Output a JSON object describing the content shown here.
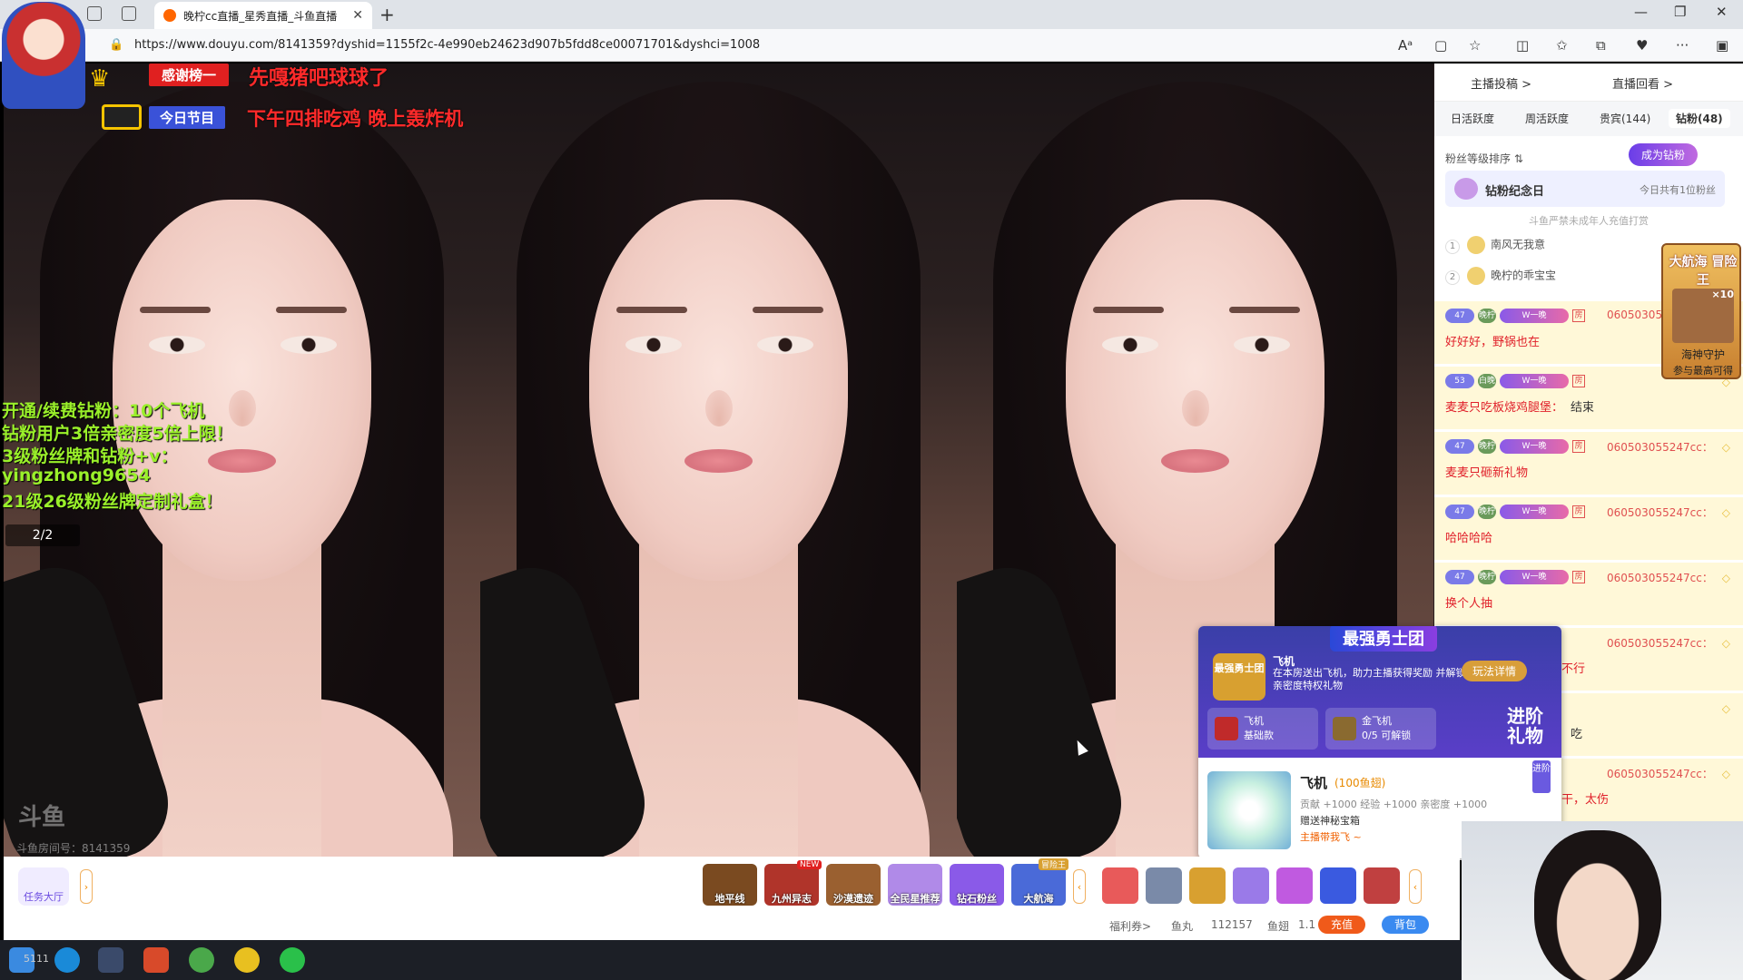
{
  "browser": {
    "tab_title": "晚柠cc直播_星秀直播_斗鱼直播",
    "url": "https://www.douyu.com/8141359?dyshid=1155f2c-4e990eb24623d907b5fdd8ce00071701&dyshci=1008",
    "icons": [
      "lock-icon",
      "read-aloud-icon",
      "reader-icon",
      "favorite-icon",
      "split-icon",
      "favorites-icon",
      "collections-icon",
      "extensions-icon",
      "more-icon",
      "sidebar-icon"
    ]
  },
  "overlay": {
    "thanks_badge": "感谢榜一",
    "thanks_text": "先嘎猪吧球球了",
    "today_badge": "今日节目",
    "today_text": "下午四排吃鸡 晚上轰炸机",
    "promo_lines": [
      "开通/续费钻粉：10个飞机",
      "钻粉用户3倍亲密度5倍上限！",
      "3级粉丝牌和钻粉+v：",
      "yingzhong9654",
      "21级26级粉丝牌定制礼盒！"
    ],
    "page_indicator": "2/2",
    "watermark": "斗鱼",
    "room_number": "斗鱼房间号：8141359"
  },
  "popup": {
    "title": "最强勇士团",
    "emblem": "最强勇士团",
    "gift_name_header": "飞机",
    "desc": "在本房送出飞机，助力主播获得奖励 并解锁亲密度特权礼物",
    "rule_button": "玩法详情",
    "card1_name": "飞机",
    "card1_sub": "基础款",
    "card2_name": "金飞机",
    "card2_sub": "0/5 可解锁",
    "advanced_gift": "进阶礼物",
    "gift_name": "飞机",
    "gift_price": "(100鱼翅)",
    "gift_stats": "贡献 +1000  经验 +1000  亲密度 +1000",
    "gift_bonus": "赠送神秘宝箱",
    "gift_link": "主播带我飞 ~",
    "adv_badge": "进阶"
  },
  "bottombar": {
    "task_hall": "任务大厅",
    "activities": [
      {
        "label": "地平线",
        "color": "#7a4a20"
      },
      {
        "label": "九州异志",
        "color": "#b0342a"
      },
      {
        "label": "沙漠遗迹",
        "color": "#9a6030"
      },
      {
        "label": "全民星推荐",
        "color": "#b08ae8"
      },
      {
        "label": "钻石粉丝",
        "color": "#8a5ae8"
      },
      {
        "label": "大航海",
        "color": "#4a6ad8"
      }
    ],
    "new_badge": "NEW",
    "navy_tag": "冒险王",
    "gift_slots": [
      "#e85a5a",
      "#7a8aa8",
      "#d8a030",
      "#9a7ae8",
      "#c05ae0",
      "#3a5ae0",
      "#c04040"
    ],
    "welfare": "福利券>",
    "fish_balls_label": "鱼丸",
    "fish_balls": "112157",
    "fish_fins_label": "鱼翅",
    "fish_fins": "1.1",
    "recharge": "充值",
    "backpack": "背包"
  },
  "sidebar": {
    "link_submit": "主播投稿 >",
    "link_replay": "直播回看 >",
    "tabs": [
      "日活跃度",
      "周活跃度",
      "贵宾(144)",
      "钻粉(48)"
    ],
    "active_tab": 3,
    "sort_label": "粉丝等级排序 ⇅",
    "become_diamond": "成为钻粉",
    "anniv_title": "钻粉纪念日",
    "anniv_count": "今日共有1位粉丝",
    "notice": "斗鱼严禁未成年人充值打赏",
    "ranks": [
      {
        "n": "1",
        "name": "南风无我意"
      },
      {
        "n": "2",
        "name": "晚柠的乖宝宝"
      }
    ],
    "messages": [
      {
        "lv": "47",
        "fan": "晚柠",
        "user": "06050305",
        "text": "好好好，野锅也在",
        "text2": ""
      },
      {
        "lv": "53",
        "fan": "白晚",
        "user": "",
        "text": "麦麦只吃板烧鸡腿堡：",
        "text2": "结束"
      },
      {
        "lv": "47",
        "fan": "晚柠",
        "user": "060503055247cc：",
        "text": "麦麦只砸新礼物",
        "text2": ""
      },
      {
        "lv": "47",
        "fan": "晚柠",
        "user": "060503055247cc：",
        "text": "哈哈哈哈",
        "text2": ""
      },
      {
        "lv": "47",
        "fan": "晚柠",
        "user": "060503055247cc：",
        "text": "换个人抽",
        "text2": ""
      },
      {
        "lv": "",
        "fan": "",
        "user": "060503055247cc：",
        "text": "不行",
        "text2": ""
      },
      {
        "lv": "",
        "fan": "",
        "user": "",
        "text": "吃",
        "text2": ""
      },
      {
        "lv": "",
        "fan": "",
        "user": "060503055247cc：",
        "text": "干，太伤",
        "text2": ""
      }
    ],
    "dia_badge": "W一晚",
    "room_badge": "房",
    "navy_title": "大航海 冒险王",
    "navy_count": "×10",
    "navy_sub": "海神守护",
    "navy_sub2": "参与最高可得"
  },
  "taskbar": {
    "icons": [
      "windows-start-icon",
      "edge-icon",
      "vscode-icon",
      "video-app-icon",
      "chrome-icon",
      "yellow-app-icon",
      "wechat-icon"
    ],
    "bottom_left": "5111"
  }
}
